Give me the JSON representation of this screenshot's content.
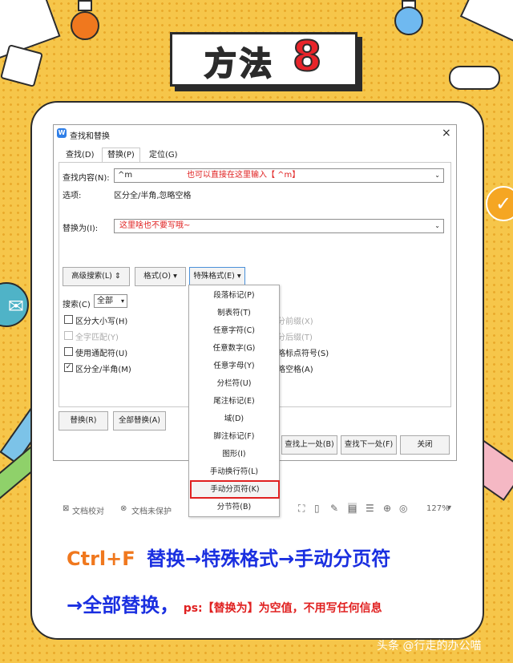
{
  "title": {
    "text": "方法",
    "number": "8"
  },
  "dialog": {
    "title": "查找和替换",
    "close": "×",
    "logo": "W",
    "tabs": [
      "查找(D)",
      "替换(P)",
      "定位(G)"
    ],
    "find_label": "查找内容(N):",
    "find_value": "^m",
    "find_note": "也可以直接在这里输入【 ^m】",
    "options_label": "选项:",
    "options_value": "区分全/半角,忽略空格",
    "replace_label": "替换为(I):",
    "replace_note": "这里啥也不要写哦~",
    "adv_search": "高级搜索(L)",
    "format": "格式(O)",
    "special": "特殊格式(E)",
    "search_label": "搜索(C)",
    "search_value": "全部",
    "checks": [
      {
        "label": "区分大小写(H)",
        "checked": false,
        "disabled": false
      },
      {
        "label": "全字匹配(Y)",
        "checked": false,
        "disabled": true
      },
      {
        "label": "使用通配符(U)",
        "checked": false,
        "disabled": false
      },
      {
        "label": "区分全/半角(M)",
        "checked": true,
        "disabled": false
      }
    ],
    "right_checks": [
      "分前缀(X)",
      "分后缀(T)",
      "略标点符号(S)",
      "略空格(A)"
    ],
    "replace_btn": "替换(R)",
    "replace_all_btn": "全部替换(A)",
    "find_prev": "查找上一处(B)",
    "find_next": "查找下一处(F)",
    "close_btn": "关闭"
  },
  "menu": {
    "items": [
      "段落标记(P)",
      "制表符(T)",
      "任意字符(C)",
      "任意数字(G)",
      "任意字母(Y)",
      "分栏符(U)",
      "尾注标记(E)",
      "域(D)",
      "脚注标记(F)",
      "图形(I)",
      "手动换行符(L)",
      "手动分页符(K)",
      "分节符(B)"
    ],
    "highlighted_index": 11,
    "highlight_color": "#e02020"
  },
  "statusbar": {
    "proof": "文档校对",
    "unprotected": "文档未保护",
    "zoom": "127%"
  },
  "bottom": {
    "line1_a": "Ctrl+F",
    "line1_b": "替换→特殊格式→手动分页符",
    "line2_a": "→全部替换，",
    "line2_b": "ps:【替换为】为空值，不用写任何信息"
  },
  "colors": {
    "accent_orange": "#f0781e",
    "accent_blue": "#1a2fe0",
    "note_red": "#e02020",
    "bg_yellow": "#f6c64a"
  },
  "watermark": "头条 @行走的办公喵"
}
